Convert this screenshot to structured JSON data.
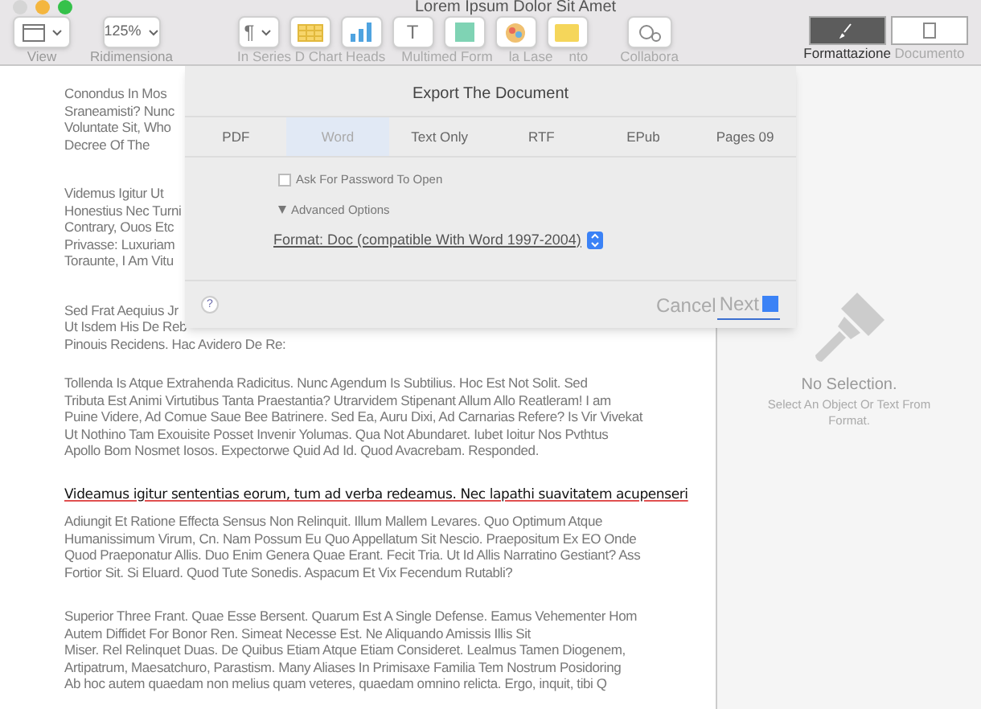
{
  "window": {
    "title": "Lorem Ipsum Dolor Sit Amet"
  },
  "toolbar": {
    "left": [
      {
        "kind": "view",
        "label": "View"
      },
      {
        "kind": "zoom",
        "value": "125%",
        "label": "Ridimensiona"
      }
    ],
    "middle": [
      {
        "kind": "paragraph",
        "glyph": "¶"
      },
      {
        "kind": "table"
      },
      {
        "kind": "chart"
      },
      {
        "kind": "text",
        "glyph": "T"
      },
      {
        "kind": "shape"
      },
      {
        "kind": "media"
      },
      {
        "kind": "comment"
      }
    ],
    "middle_labels": [
      "In Series D Chart Heads",
      "Multimed Form",
      "la Lase",
      "nto"
    ],
    "collaborate": {
      "label": "Collabora"
    },
    "right": [
      {
        "kind": "format",
        "label": "Formattazione",
        "selected": true
      },
      {
        "kind": "document",
        "label": "Documento",
        "selected": false
      }
    ]
  },
  "document": {
    "top_paragraphs": [
      [
        "Conondus In Mos",
        "Sraneamisti? Nunc",
        "Voluntate Sit, Who",
        "Decree Of The"
      ],
      [
        "Videmus Igitur Ut",
        "Honestius Nec Turni",
        "Contrary, Ouos Etc",
        "Privasse: Luxuriam",
        "Toraunte, I Am Vitu"
      ],
      [
        "Sed Frat Aequius Jr",
        "Ut Isdem His De Reb",
        "Pinouis Recidens. Hac Avidero De Re:"
      ]
    ],
    "paragraphs": [
      {
        "kind": "plain",
        "lines": [
          "Tollenda Is Atque Extrahenda Radicitus. Nunc Agendum Is Subtilius. Hoc Est Not Solit. Sed",
          "Tributa Est Animi Virtutibus Tanta Praestantia? Utrarvidem Stipenant Allum Allo Reatleram! I am",
          "Puine Videre, Ad Comue Saue Bee Batrinere. Sed Ea, Auru Dixi, Ad Carnarias Refere? Is Vir Vivekat",
          "Ut Nothino Tam Exouisite Posset Invenir Yolumas. Qua Not Abundaret. Iubet Ioitur Nos Pvthtus",
          "Apollo Bom Nosmet Iosos. Expectorwe Quid Ad Id. Quod Avacrebam. Responded."
        ]
      },
      {
        "kind": "mixed",
        "heading": "Videamus igitur sententias eorum, tum ad verba redeamus. Nec lapathi suavitatem acupenseri",
        "lines": [
          "Adiungit Et Ratione Effecta Sensus Non Relinquit. Illum Mallem Levares. Quo Optimum Atque",
          "Humanissimum Virum, Cn. Nam Possum Eu Quo Appellatum Sit Nescio. Praepositum Ex EO Onde",
          "Quod Praeponatur Allis. Duo Enim Genera Quae Erant. Fecit Tria. Ut Id Allis Narratino Gestiant? Ass",
          "Fortior Sit. Si Eluard. Quod Tute Sonedis. Aspacum Et Vix Fecendum Rutabli?"
        ]
      },
      {
        "kind": "plain",
        "lines": [
          "Superior Three Frant. Quae Esse Bersent. Quarum Est A Single Defense. Eamus Vehementer Hom",
          "Autem Diffidet For Bonor Ren. Simeat Necesse Est. Ne Aliquando Amissis Illis Sit",
          "Miser. Rel Relinquet Duas. De Quibus Etiam Atque Etiam Consideret. Lealmus Tamen Diogenem,",
          "Artipatrum, Maesatchuro, Parastism. Many Aliases In Primisaxe Familia Tem Nostrum Posidoring",
          "Ab hoc autem quaedam non melius quam veteres, quaedam omnino relicta. Ergo, inquit, tibi Q"
        ]
      }
    ]
  },
  "dialog": {
    "title": "Export The Document",
    "tabs": [
      {
        "label": "PDF",
        "selected": false
      },
      {
        "label": "Word",
        "selected": true
      },
      {
        "label": "Text Only",
        "selected": false
      },
      {
        "label": "RTF",
        "selected": false
      },
      {
        "label": "EPub",
        "selected": false
      },
      {
        "label": "Pages 09",
        "selected": false
      }
    ],
    "password": {
      "label": "Ask For Password To Open",
      "checked": false
    },
    "advanced": {
      "label": "Advanced Options",
      "expanded": true
    },
    "format": {
      "value": "Format: Doc (compatible With Word 1997-2004)"
    },
    "help": "?",
    "buttons": [
      {
        "kind": "cancel",
        "label": "Cancel"
      },
      {
        "kind": "next",
        "label": "Next"
      }
    ]
  },
  "sidebar": {
    "title": "No Selection.",
    "hint": "Select An Object Or Text From Format."
  }
}
